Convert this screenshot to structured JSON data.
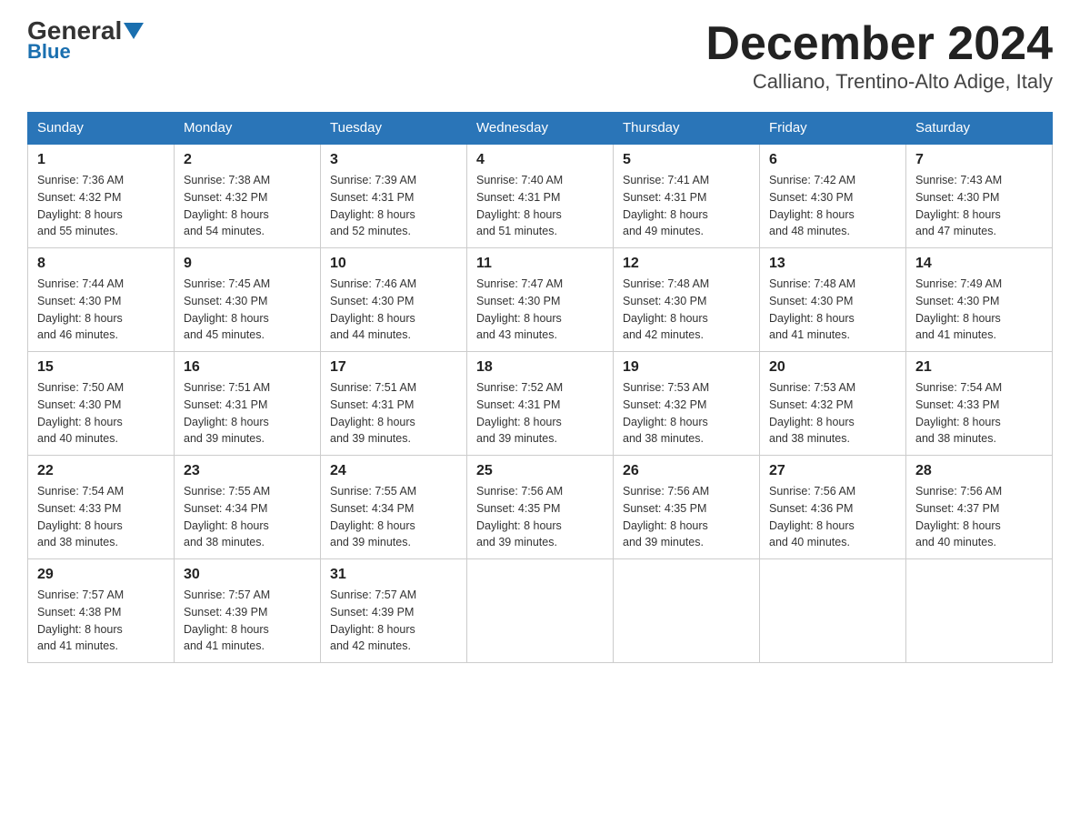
{
  "header": {
    "logo_general": "General",
    "logo_blue": "Blue",
    "title": "December 2024",
    "subtitle": "Calliano, Trentino-Alto Adige, Italy"
  },
  "days_of_week": [
    "Sunday",
    "Monday",
    "Tuesday",
    "Wednesday",
    "Thursday",
    "Friday",
    "Saturday"
  ],
  "weeks": [
    [
      {
        "day": "1",
        "sunrise": "7:36 AM",
        "sunset": "4:32 PM",
        "daylight": "8 hours and 55 minutes."
      },
      {
        "day": "2",
        "sunrise": "7:38 AM",
        "sunset": "4:32 PM",
        "daylight": "8 hours and 54 minutes."
      },
      {
        "day": "3",
        "sunrise": "7:39 AM",
        "sunset": "4:31 PM",
        "daylight": "8 hours and 52 minutes."
      },
      {
        "day": "4",
        "sunrise": "7:40 AM",
        "sunset": "4:31 PM",
        "daylight": "8 hours and 51 minutes."
      },
      {
        "day": "5",
        "sunrise": "7:41 AM",
        "sunset": "4:31 PM",
        "daylight": "8 hours and 49 minutes."
      },
      {
        "day": "6",
        "sunrise": "7:42 AM",
        "sunset": "4:30 PM",
        "daylight": "8 hours and 48 minutes."
      },
      {
        "day": "7",
        "sunrise": "7:43 AM",
        "sunset": "4:30 PM",
        "daylight": "8 hours and 47 minutes."
      }
    ],
    [
      {
        "day": "8",
        "sunrise": "7:44 AM",
        "sunset": "4:30 PM",
        "daylight": "8 hours and 46 minutes."
      },
      {
        "day": "9",
        "sunrise": "7:45 AM",
        "sunset": "4:30 PM",
        "daylight": "8 hours and 45 minutes."
      },
      {
        "day": "10",
        "sunrise": "7:46 AM",
        "sunset": "4:30 PM",
        "daylight": "8 hours and 44 minutes."
      },
      {
        "day": "11",
        "sunrise": "7:47 AM",
        "sunset": "4:30 PM",
        "daylight": "8 hours and 43 minutes."
      },
      {
        "day": "12",
        "sunrise": "7:48 AM",
        "sunset": "4:30 PM",
        "daylight": "8 hours and 42 minutes."
      },
      {
        "day": "13",
        "sunrise": "7:48 AM",
        "sunset": "4:30 PM",
        "daylight": "8 hours and 41 minutes."
      },
      {
        "day": "14",
        "sunrise": "7:49 AM",
        "sunset": "4:30 PM",
        "daylight": "8 hours and 41 minutes."
      }
    ],
    [
      {
        "day": "15",
        "sunrise": "7:50 AM",
        "sunset": "4:30 PM",
        "daylight": "8 hours and 40 minutes."
      },
      {
        "day": "16",
        "sunrise": "7:51 AM",
        "sunset": "4:31 PM",
        "daylight": "8 hours and 39 minutes."
      },
      {
        "day": "17",
        "sunrise": "7:51 AM",
        "sunset": "4:31 PM",
        "daylight": "8 hours and 39 minutes."
      },
      {
        "day": "18",
        "sunrise": "7:52 AM",
        "sunset": "4:31 PM",
        "daylight": "8 hours and 39 minutes."
      },
      {
        "day": "19",
        "sunrise": "7:53 AM",
        "sunset": "4:32 PM",
        "daylight": "8 hours and 38 minutes."
      },
      {
        "day": "20",
        "sunrise": "7:53 AM",
        "sunset": "4:32 PM",
        "daylight": "8 hours and 38 minutes."
      },
      {
        "day": "21",
        "sunrise": "7:54 AM",
        "sunset": "4:33 PM",
        "daylight": "8 hours and 38 minutes."
      }
    ],
    [
      {
        "day": "22",
        "sunrise": "7:54 AM",
        "sunset": "4:33 PM",
        "daylight": "8 hours and 38 minutes."
      },
      {
        "day": "23",
        "sunrise": "7:55 AM",
        "sunset": "4:34 PM",
        "daylight": "8 hours and 38 minutes."
      },
      {
        "day": "24",
        "sunrise": "7:55 AM",
        "sunset": "4:34 PM",
        "daylight": "8 hours and 39 minutes."
      },
      {
        "day": "25",
        "sunrise": "7:56 AM",
        "sunset": "4:35 PM",
        "daylight": "8 hours and 39 minutes."
      },
      {
        "day": "26",
        "sunrise": "7:56 AM",
        "sunset": "4:35 PM",
        "daylight": "8 hours and 39 minutes."
      },
      {
        "day": "27",
        "sunrise": "7:56 AM",
        "sunset": "4:36 PM",
        "daylight": "8 hours and 40 minutes."
      },
      {
        "day": "28",
        "sunrise": "7:56 AM",
        "sunset": "4:37 PM",
        "daylight": "8 hours and 40 minutes."
      }
    ],
    [
      {
        "day": "29",
        "sunrise": "7:57 AM",
        "sunset": "4:38 PM",
        "daylight": "8 hours and 41 minutes."
      },
      {
        "day": "30",
        "sunrise": "7:57 AM",
        "sunset": "4:39 PM",
        "daylight": "8 hours and 41 minutes."
      },
      {
        "day": "31",
        "sunrise": "7:57 AM",
        "sunset": "4:39 PM",
        "daylight": "8 hours and 42 minutes."
      },
      null,
      null,
      null,
      null
    ]
  ],
  "labels": {
    "sunrise": "Sunrise:",
    "sunset": "Sunset:",
    "daylight": "Daylight:"
  },
  "colors": {
    "header_bg": "#2a75b8",
    "header_text": "#ffffff",
    "accent": "#1a6faf"
  }
}
